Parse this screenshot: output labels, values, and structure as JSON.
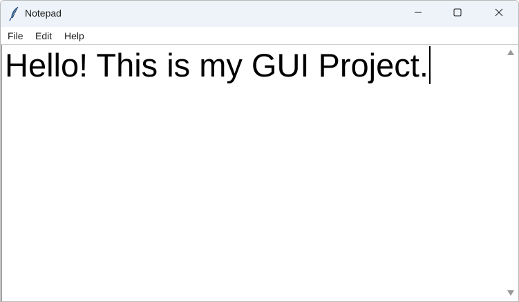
{
  "window": {
    "title": "Notepad",
    "app_icon": "quill-feather-icon",
    "controls": {
      "minimize_icon": "minimize-icon",
      "maximize_icon": "maximize-icon",
      "close_icon": "close-icon"
    }
  },
  "menubar": {
    "items": [
      {
        "label": "File"
      },
      {
        "label": "Edit"
      },
      {
        "label": "Help"
      }
    ]
  },
  "editor": {
    "text": "Hello! This is my GUI Project."
  },
  "scrollbar": {
    "up_icon": "scroll-up-arrow-icon",
    "down_icon": "scroll-down-arrow-icon"
  },
  "colors": {
    "titlebar_bg": "#eef3f9",
    "text": "#000000"
  }
}
